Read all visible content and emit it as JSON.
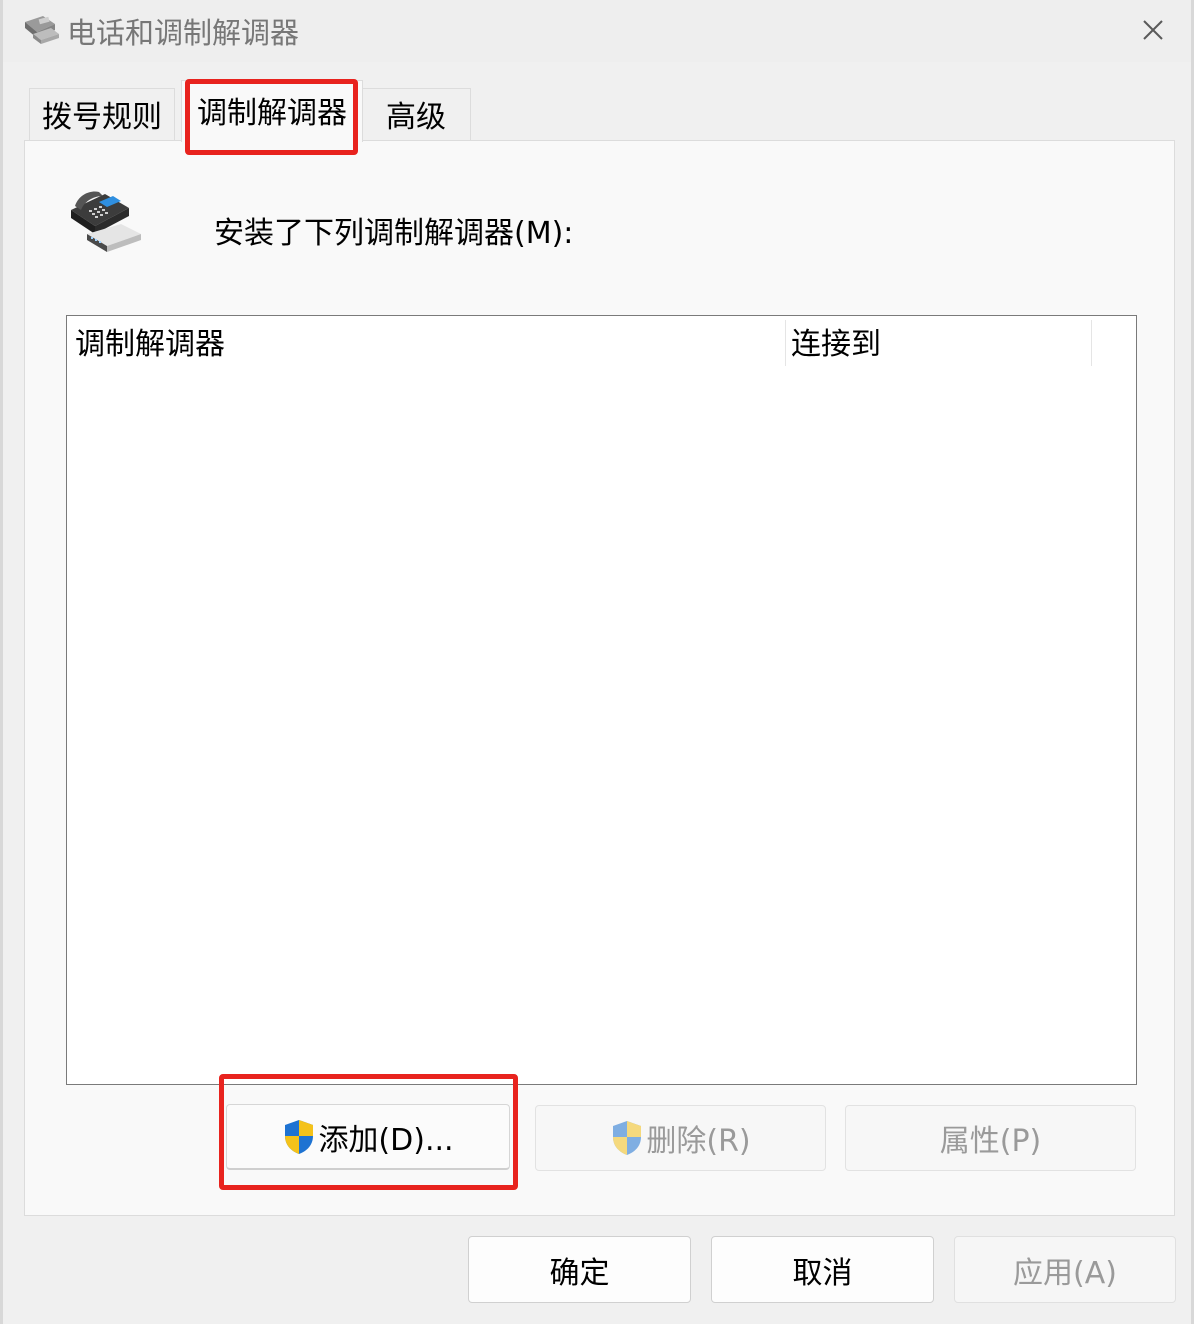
{
  "window": {
    "title": "电话和调制解调器",
    "close_label": "✕"
  },
  "tabs": [
    {
      "label": "拨号规则",
      "active": false
    },
    {
      "label": "调制解调器",
      "active": true
    },
    {
      "label": "高级",
      "active": false
    }
  ],
  "modems_tab": {
    "installed_label": "安装了下列调制解调器(M):",
    "list": {
      "columns": [
        "调制解调器",
        "连接到"
      ],
      "rows": []
    },
    "buttons": {
      "add": "添加(D)...",
      "remove": "删除(R)",
      "properties": "属性(P)"
    }
  },
  "footer": {
    "ok": "确定",
    "cancel": "取消",
    "apply": "应用(A)"
  },
  "colors": {
    "highlight_box": "#e8231e",
    "shield_blue": "#1e73d2",
    "shield_yellow": "#f4c21a"
  },
  "icons": {
    "title": "phone-modem-icon",
    "modem": "phone-modem-icon",
    "uac": "uac-shield-icon"
  }
}
